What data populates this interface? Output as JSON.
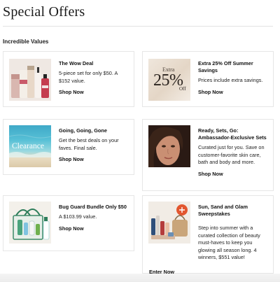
{
  "page": {
    "title": "Special Offers",
    "section_label": "Incredible Values"
  },
  "offers": [
    {
      "title": "The Wow Deal",
      "description": "5-piece set for only $50. A $152 value.",
      "cta": "Shop Now",
      "thumb": "skincare-products-set"
    },
    {
      "title": "Extra 25% Off Summer Savings",
      "description": "Prices include extra savings.",
      "cta": "Shop Now",
      "thumb": "extra-25-off-badge",
      "thumb_line1": "Extra",
      "thumb_big": "25%",
      "thumb_small": "Off"
    },
    {
      "title": "Going, Going, Gone",
      "description": "Get the best deals on your faves. Final sale.",
      "cta": "Shop Now",
      "thumb": "clearance-beach-image",
      "thumb_text": "Clearance"
    },
    {
      "title": "Ready, Sets, Go: Ambassador-Exclusive Sets",
      "description": "Curated just for you. Save on customer-favorite skin care, bath and body and more.",
      "cta": "Shop Now",
      "thumb": "model-portrait"
    },
    {
      "title": "Bug Guard Bundle Only $50",
      "description": "A $103.99 value.",
      "cta": "Shop Now",
      "thumb": "bug-guard-tote-bundle"
    },
    {
      "title": "Sun, Sand and Glam Sweepstakes",
      "description": "Step into summer with a curated collection of beauty must-haves to keep you glowing all season long. 4 winners, $551 value!",
      "cta": "Enter Now",
      "thumb": "beauty-collection-prize"
    }
  ]
}
